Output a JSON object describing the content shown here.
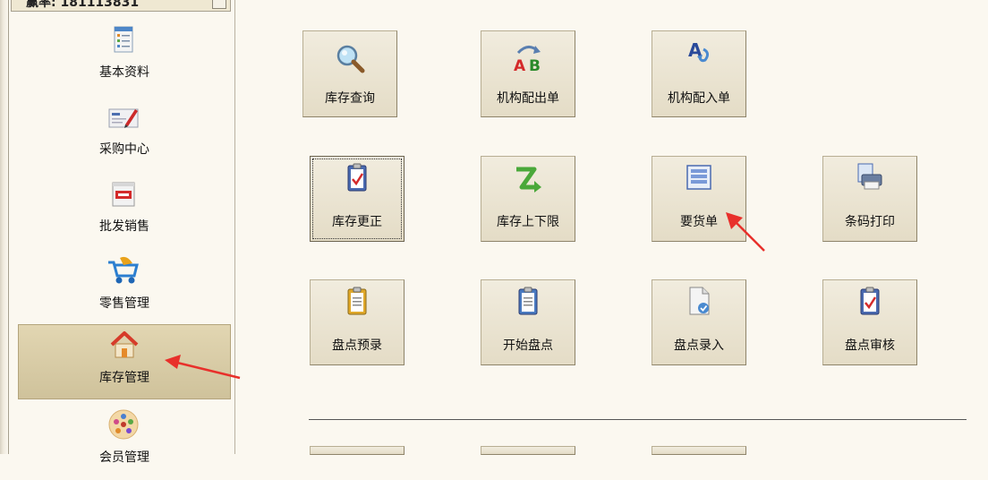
{
  "sidebar": {
    "header_text": "赢率: 181113831",
    "items": [
      {
        "label": "基本资料",
        "icon": "document-list-icon"
      },
      {
        "label": "采购中心",
        "icon": "purchase-order-icon"
      },
      {
        "label": "批发销售",
        "icon": "sale-tag-icon"
      },
      {
        "label": "零售管理",
        "icon": "shopping-cart-icon"
      },
      {
        "label": "库存管理",
        "icon": "house-icon",
        "active": true
      },
      {
        "label": "会员管理",
        "icon": "members-icon"
      }
    ]
  },
  "tiles": {
    "inventory_query": "库存查询",
    "branch_out": "机构配出单",
    "branch_in": "机构配入单",
    "inventory_correct": "库存更正",
    "stock_limits": "库存上下限",
    "requisition": "要货单",
    "barcode_print": "条码打印",
    "count_pre": "盘点预录",
    "count_start": "开始盘点",
    "count_entry": "盘点录入",
    "count_audit": "盘点审核"
  },
  "colors": {
    "annotation_arrow": "#e8302b",
    "active_nav": "#d8cca5"
  }
}
